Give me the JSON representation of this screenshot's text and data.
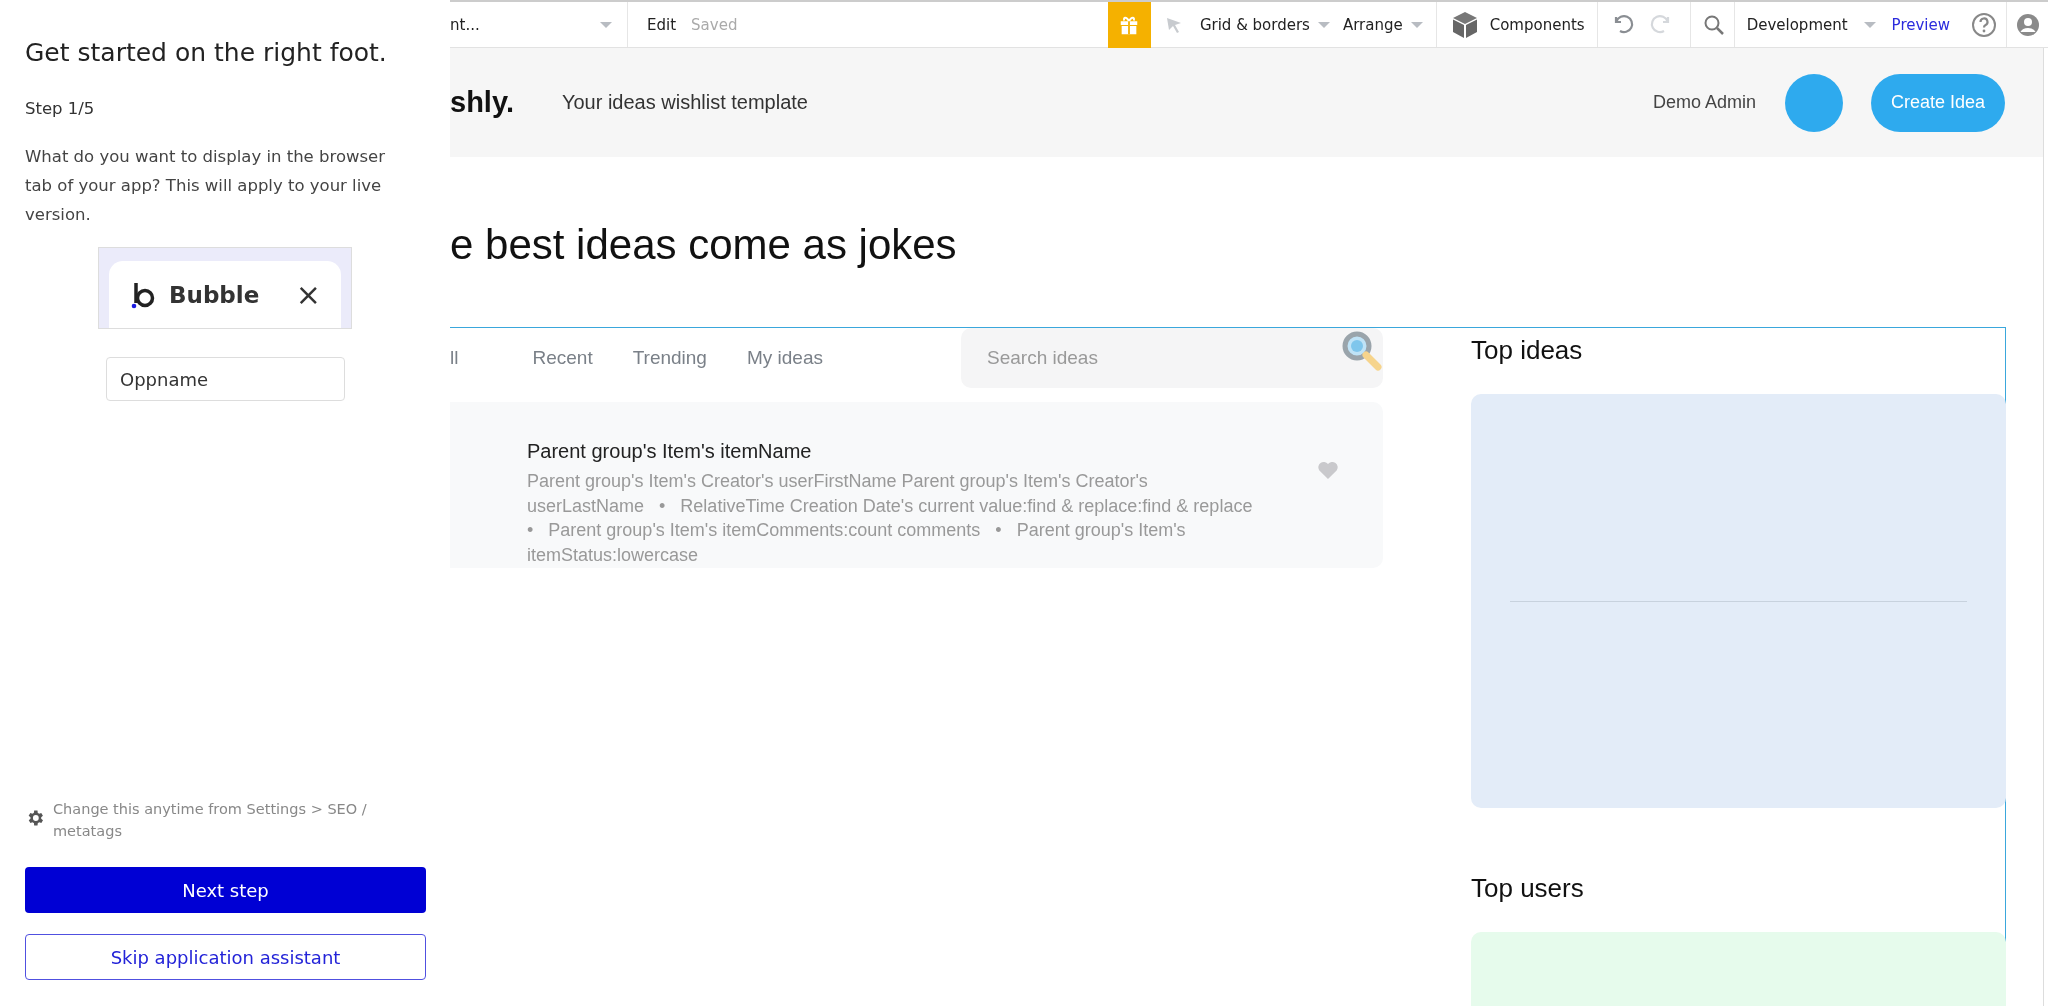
{
  "assistant": {
    "title": "Get started on the right foot.",
    "step": "Step 1/5",
    "question": "What do you want to display in the browser tab of your app? This will apply to your live version.",
    "tab_preview": {
      "title": "Bubble",
      "close": "×"
    },
    "app_name_field": {
      "value": "Oppname"
    },
    "note": "Change this anytime from Settings > SEO / metatags",
    "buttons": [
      {
        "label": "Next step",
        "kind": "primary"
      },
      {
        "label": "Skip application assistant",
        "kind": "secondary"
      }
    ]
  },
  "toolbar": {
    "page_dropdown": "nt...",
    "mode": "Edit",
    "save_status": "Saved",
    "menus": [
      {
        "label": "Grid & borders"
      },
      {
        "label": "Arrange"
      }
    ],
    "components": "Components",
    "history": [
      {
        "kind": "undo",
        "disabled": false
      },
      {
        "kind": "redo",
        "disabled": true
      }
    ],
    "environment": "Development",
    "preview": "Preview"
  },
  "canvas": {
    "header": {
      "logo": "shly.",
      "tagline": "Your ideas wishlist template",
      "user_name": "Demo Admin",
      "create_button": "Create Idea"
    },
    "heading": "e best ideas come as jokes",
    "filter_tabs": [
      {
        "label": "ll",
        "selected": false
      },
      {
        "label": "Recent",
        "selected": false
      },
      {
        "label": "Trending",
        "selected": false
      },
      {
        "label": "My ideas",
        "selected": false
      }
    ],
    "search": {
      "placeholder": "Search ideas"
    },
    "idea_card": {
      "title": "Parent group's Item's itemName",
      "meta": "Parent group's Item's Creator's userFirstName Parent group's Item's Creator's userLastName   •   RelativeTime Creation Date's current value:find & replace:find & replace   •   Parent group's Item's itemComments:count comments   •   Parent group's Item's itemStatus:lowercase"
    },
    "top_ideas": {
      "title": "Top ideas"
    },
    "top_users": {
      "title": "Top users"
    }
  }
}
